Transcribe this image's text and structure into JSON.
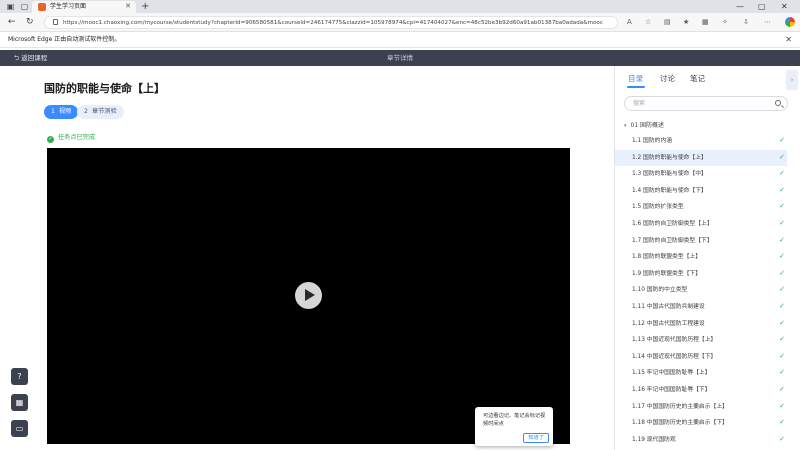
{
  "browser": {
    "tab_title": "学生学习页面",
    "url": "https://mooc1.chaoxing.com/mycourse/studentstudy?chapterId=906580581&courseId=246174775&clazzid=105978974&cpi=417404027&enc=48c52be3b92d60a91ab01387ba0adada&mooc2=1&openc=182d0c755743da797a..."
  },
  "infobar": {
    "text": "Microsoft Edge 正由自动测试软件控制。"
  },
  "header": {
    "back_label": "返回课程",
    "title": "章节详情"
  },
  "main": {
    "lesson_title": "国防的职能与使命【上】",
    "tabs": [
      {
        "num": "1",
        "label": "视频",
        "active": true
      },
      {
        "num": "2",
        "label": "章节测验",
        "active": false
      }
    ],
    "task_status": "任务点已完成",
    "tip": {
      "text": "可边看边记、笔记会标记视频时间点",
      "button": "知道了"
    }
  },
  "sidebar": {
    "tabs": [
      "目录",
      "讨论",
      "笔记"
    ],
    "search_placeholder": "搜索",
    "chapter": "01 国防概述",
    "items": [
      {
        "label": "1.1 国防的内涵",
        "done": true,
        "current": false
      },
      {
        "label": "1.2 国防的职能与使命【上】",
        "done": true,
        "current": true
      },
      {
        "label": "1.3 国防的职能与使命【中】",
        "done": true,
        "current": false
      },
      {
        "label": "1.4 国防的职能与使命【下】",
        "done": true,
        "current": false
      },
      {
        "label": "1.5 国防的扩张类型",
        "done": true,
        "current": false
      },
      {
        "label": "1.6 国防的自卫防御类型【上】",
        "done": true,
        "current": false
      },
      {
        "label": "1.7 国防的自卫防御类型【下】",
        "done": true,
        "current": false
      },
      {
        "label": "1.8 国防的联盟类型【上】",
        "done": true,
        "current": false
      },
      {
        "label": "1.9 国防的联盟类型【下】",
        "done": true,
        "current": false
      },
      {
        "label": "1.10 国防的中立类型",
        "done": true,
        "current": false
      },
      {
        "label": "1.11 中国古代国防兵制建设",
        "done": true,
        "current": false
      },
      {
        "label": "1.12 中国古代国防工程建设",
        "done": true,
        "current": false
      },
      {
        "label": "1.13 中国近现代国防历程【上】",
        "done": true,
        "current": false
      },
      {
        "label": "1.14 中国近现代国防历程【下】",
        "done": true,
        "current": false
      },
      {
        "label": "1.15 牢记中国国防耻辱【上】",
        "done": true,
        "current": false
      },
      {
        "label": "1.16 牢记中国国防耻辱【下】",
        "done": true,
        "current": false
      },
      {
        "label": "1.17 中国国防历史的主要启示【上】",
        "done": true,
        "current": false
      },
      {
        "label": "1.18 中国国防历史的主要启示【下】",
        "done": true,
        "current": false
      },
      {
        "label": "1.19 现代国防观",
        "done": true,
        "current": false
      }
    ]
  },
  "icons": {
    "check": "✓",
    "back": "⮌",
    "collapse": "›",
    "play": "play-icon",
    "side_tools": [
      "help-icon",
      "qr-code-icon",
      "chat-icon"
    ]
  },
  "colors": {
    "accent": "#3a8bff",
    "success": "#2fae53",
    "header_bg": "#3c4150"
  }
}
